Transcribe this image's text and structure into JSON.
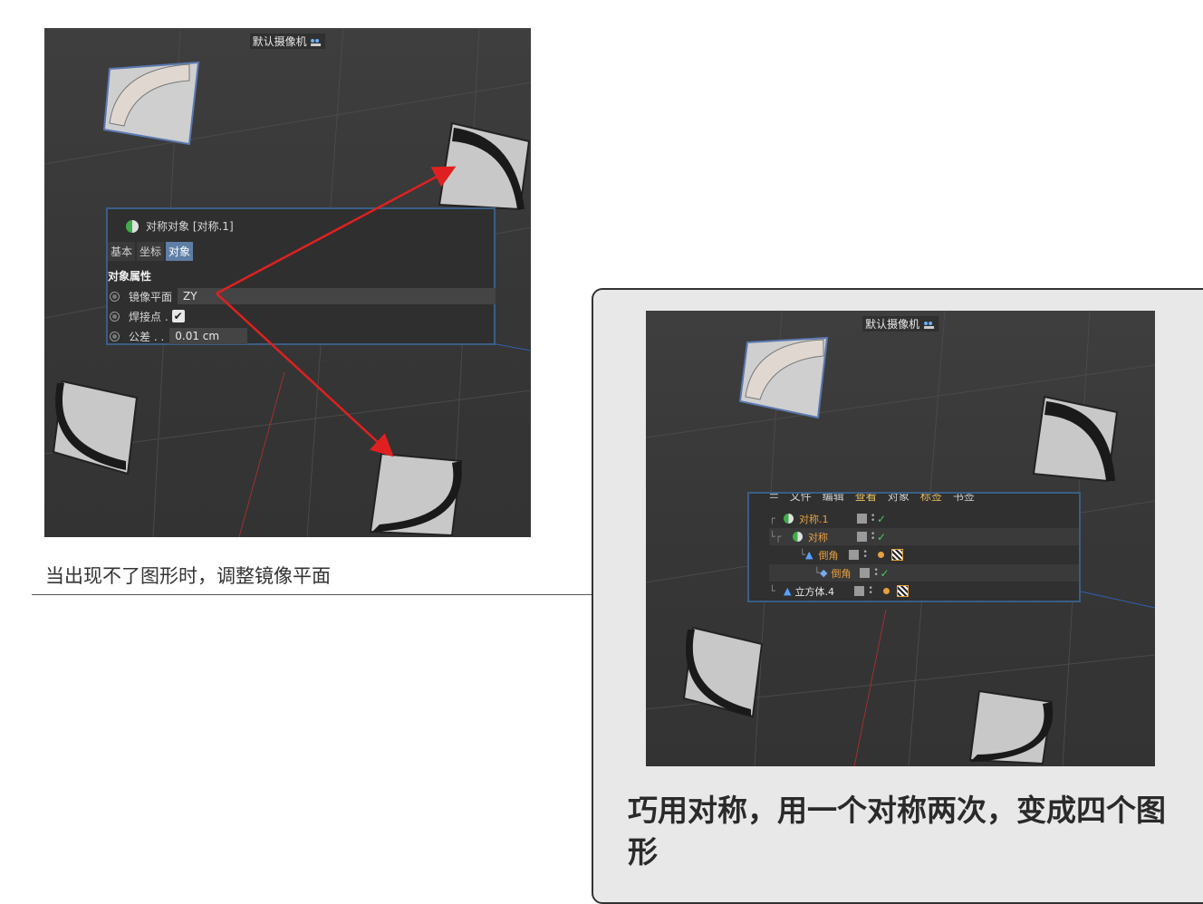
{
  "viewport1": {
    "camera_label": "默认摄像机",
    "camera_icon": "camera-icon"
  },
  "attribute_panel": {
    "title": "对称对象 [对称.1]",
    "tabs": [
      "基本",
      "坐标",
      "对象"
    ],
    "active_tab": "对象",
    "section": "对象属性",
    "mirror_plane_label": "镜像平面",
    "mirror_plane_value": "ZY",
    "weld_label": "焊接点 .",
    "weld_checked": true,
    "tolerance_label": "公差 . .",
    "tolerance_value": "0.01 cm"
  },
  "caption_left": "当出现不了图形时，调整镜像平面",
  "viewport2": {
    "camera_label": "默认摄像机"
  },
  "object_manager": {
    "menu": [
      "文件",
      "编辑",
      "查看",
      "对象",
      "标签",
      "书签"
    ],
    "rows": [
      {
        "name": "对称.1",
        "color": "orange"
      },
      {
        "name": "对称",
        "color": "orange"
      },
      {
        "name": "倒角",
        "color": "orange"
      },
      {
        "name": "倒角",
        "color": "orange"
      },
      {
        "name": "立方体.4",
        "color": "white"
      }
    ]
  },
  "caption_right": "巧用对称，用一个对称两次，变成四个图形",
  "colors": {
    "accent_blue": "#3a5e86",
    "active_tab": "#5e7ea6",
    "object_orange": "#e7a040",
    "arrow_red": "#e02020"
  }
}
